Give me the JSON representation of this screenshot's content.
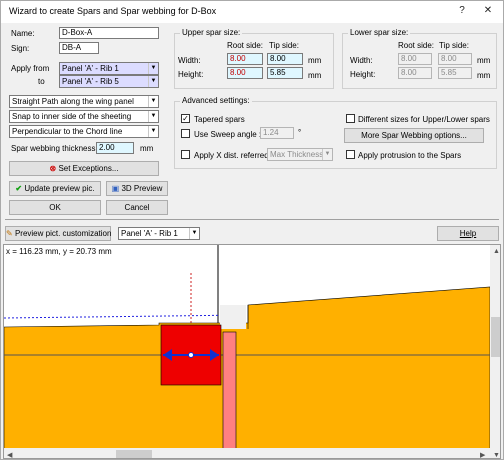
{
  "window": {
    "title": "Wizard to create Spars and Spar webbing for D-Box",
    "help_char": "?",
    "close_char": "✕"
  },
  "left": {
    "name_label": "Name:",
    "name_value": "D-Box-A",
    "sign_label": "Sign:",
    "sign_value": "DB-A",
    "apply_from_label": "Apply from",
    "apply_from_value": "Panel 'A' - Rib 1",
    "to_label": "to",
    "to_value": "Panel 'A' - Rib 5",
    "path_option": "Straight Path along the wing panel",
    "snap_option": "Snap to inner side of the sheeting",
    "perp_option": "Perpendicular to the Chord line",
    "web_thickness_label": "Spar webbing thickness:",
    "web_thickness_value": "2.00",
    "web_thickness_unit": "mm",
    "set_exceptions": "Set Exceptions...",
    "update_preview": "Update preview pic.",
    "preview_3d": "3D Preview",
    "ok": "OK",
    "cancel": "Cancel"
  },
  "upper": {
    "title": "Upper spar size:",
    "root_side": "Root side:",
    "tip_side": "Tip side:",
    "width_label": "Width:",
    "width_root": "8.00",
    "width_tip": "8.00",
    "height_label": "Height:",
    "height_root": "8.00",
    "height_tip": "5.85",
    "unit": "mm"
  },
  "lower": {
    "title": "Lower spar size:",
    "root_side": "Root side:",
    "tip_side": "Tip side:",
    "width_label": "Width:",
    "width_root": "8.00",
    "width_tip": "8.00",
    "height_label": "Height:",
    "height_root": "8.00",
    "height_tip": "5.85",
    "unit": "mm"
  },
  "advanced": {
    "title": "Advanced settings:",
    "tapered_label": "Tapered spars",
    "tapered_checked": true,
    "sweep_label": "Use Sweep angle :",
    "sweep_value": "1.24",
    "sweep_unit": "°",
    "apply_x_label": "Apply X dist. referred to:",
    "apply_x_value": "Max Thickness",
    "diff_sizes_label": "Different sizes for Upper/Lower spars",
    "more_webbing": "More Spar Webbing options...",
    "protrusion_label": "Apply protrusion to the Spars"
  },
  "preview": {
    "customization_btn": "Preview pict. customization",
    "panel_select": "Panel 'A' - Rib 1",
    "help_btn": "Help",
    "coords": "x = 116.23 mm, y = 20.73 mm"
  },
  "colors": {
    "sheeting": "#ffb000",
    "spar": "#ee0000",
    "web": "#ff8080",
    "arrow": "#1030d0",
    "dotted_line": "#2020e0",
    "axis_line": "#cc2020"
  }
}
